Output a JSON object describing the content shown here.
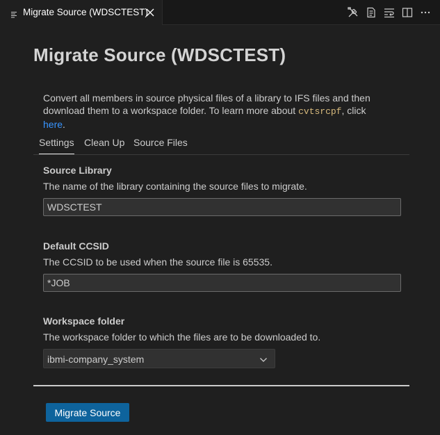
{
  "window": {
    "tab_title": "Migrate Source (WDSCTEST)",
    "tab_icon": "preview-icon",
    "close_icon": "close-icon",
    "actions": [
      {
        "icon": "tools-icon"
      },
      {
        "icon": "open-preview-icon"
      },
      {
        "icon": "word-wrap-icon"
      },
      {
        "icon": "split-editor-icon"
      },
      {
        "icon": "more-actions-icon"
      }
    ]
  },
  "page": {
    "title": "Migrate Source (WDSCTEST)",
    "description_before": "Convert all members in source physical files of a library to IFS files and then download them to a workspace folder. To learn more about ",
    "description_code": "cvtsrcpf",
    "description_middle": ", click ",
    "description_link": "here",
    "description_after": "."
  },
  "tabs": [
    {
      "label": "Settings",
      "active": true
    },
    {
      "label": "Clean Up",
      "active": false
    },
    {
      "label": "Source Files",
      "active": false
    }
  ],
  "fields": {
    "source_library": {
      "label": "Source Library",
      "help": "The name of the library containing the source files to migrate.",
      "value": "WDSCTEST"
    },
    "default_ccsid": {
      "label": "Default CCSID",
      "help": "The CCSID to be used when the source file is 65535.",
      "value": "*JOB"
    },
    "workspace_folder": {
      "label": "Workspace folder",
      "help": "The workspace folder to which the files are to be downloaded to.",
      "selected": "ibmi-company_system"
    }
  },
  "submit_label": "Migrate Source",
  "colors": {
    "background": "#1f1f1f",
    "accent_button": "#0e639c",
    "link": "#3794ff",
    "code": "#d7ba7d"
  }
}
